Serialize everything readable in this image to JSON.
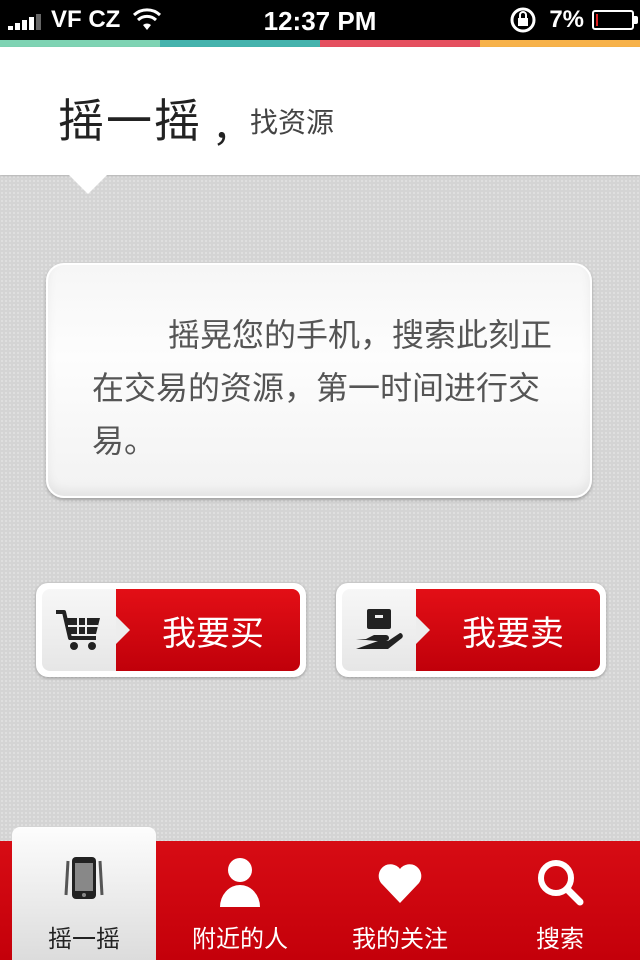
{
  "status_bar": {
    "carrier": "VF CZ",
    "time": "12:37 PM",
    "battery": "7%",
    "battery_level": 0.07
  },
  "color_strip": [
    "#7ed3b3",
    "#45b3ad",
    "#e5505f",
    "#f7b24a"
  ],
  "header": {
    "title": "摇一摇",
    "comma": "，",
    "subtitle": "找资源"
  },
  "card": {
    "text": "摇晃您的手机，搜索此刻正在交易的资源，第一时间进行交易。"
  },
  "actions": {
    "buy": {
      "label": "我要买",
      "icon": "shopping-cart-icon"
    },
    "sell": {
      "label": "我要卖",
      "icon": "package-hand-icon"
    }
  },
  "tabs": [
    {
      "label": "摇一摇",
      "icon": "phone-shake-icon",
      "active": true
    },
    {
      "label": "附近的人",
      "icon": "person-icon",
      "active": false
    },
    {
      "label": "我的关注",
      "icon": "heart-icon",
      "active": false
    },
    {
      "label": "搜索",
      "icon": "search-icon",
      "active": false
    }
  ],
  "colors": {
    "brand_red": "#c8000b",
    "text_gray": "#555555"
  }
}
